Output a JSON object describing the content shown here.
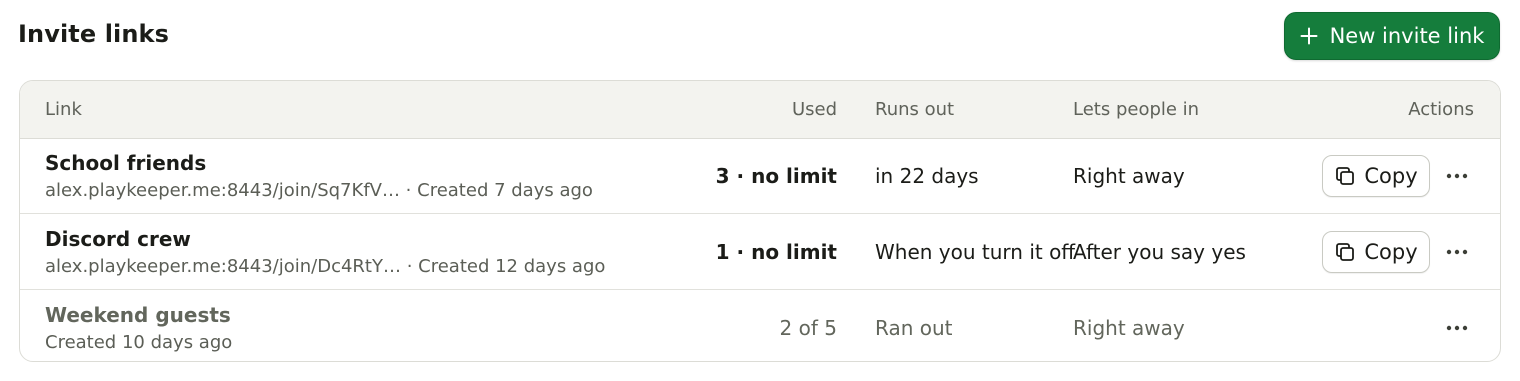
{
  "header": {
    "title": "Invite links",
    "new_button_label": "New invite link"
  },
  "colors": {
    "accent_green": "#157d3c",
    "header_bg": "#f3f3ef",
    "muted_text": "#5b5e56"
  },
  "table": {
    "columns": {
      "link": "Link",
      "used": "Used",
      "runs_out": "Runs out",
      "lets_people_in": "Lets people in",
      "actions": "Actions"
    },
    "rows": [
      {
        "name": "School friends",
        "meta": "alex.playkeeper.me:8443/join/Sq7KfV… · Created 7 days ago",
        "used": "3 · no limit",
        "runs_out": "in 22 days",
        "lets_people_in": "Right away",
        "copy_label": "Copy",
        "state": "active"
      },
      {
        "name": "Discord crew",
        "meta": "alex.playkeeper.me:8443/join/Dc4RtY… · Created 12 days ago",
        "used": "1 · no limit",
        "runs_out": "When you turn it off",
        "lets_people_in": "After you say yes",
        "copy_label": "Copy",
        "state": "active"
      },
      {
        "name": "Weekend guests",
        "meta": "Created 10 days ago",
        "used": "2 of 5",
        "runs_out": "Ran out",
        "lets_people_in": "Right away",
        "state": "expired"
      }
    ]
  },
  "icons": {
    "new_button": "plus-icon",
    "copy": "copy-icon",
    "more": "more-horizontal-icon"
  }
}
